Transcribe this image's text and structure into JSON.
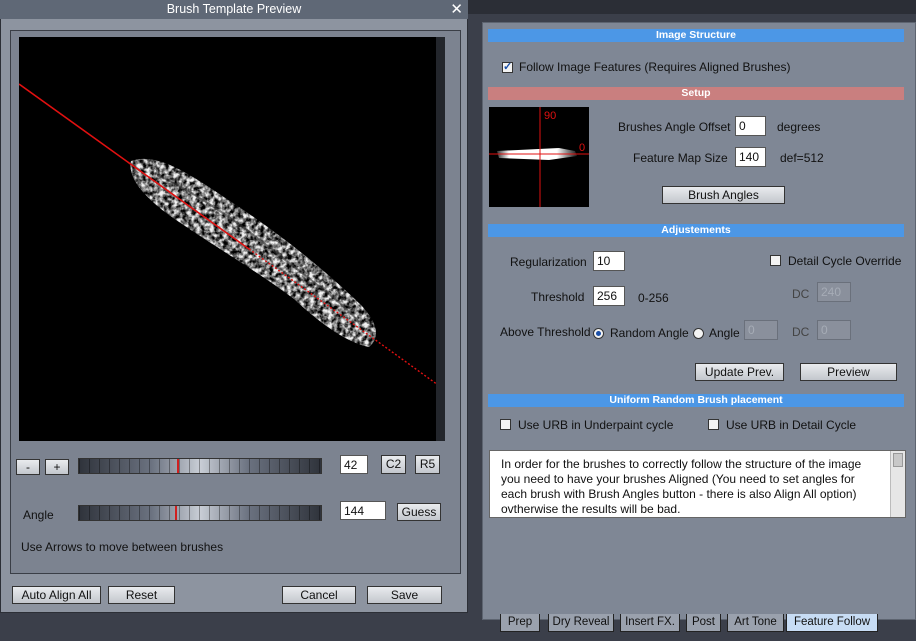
{
  "dialog": {
    "title": "Brush Template Preview",
    "close_label": "✕",
    "minus_label": "-",
    "plus_label": "+",
    "brush_index": "42",
    "c2_label": "C2",
    "r5_label": "R5",
    "angle_label": "Angle",
    "angle_value": "144",
    "guess_label": "Guess",
    "hint": "Use Arrows to move between brushes",
    "auto_align_label": "Auto Align All",
    "reset_label": "Reset",
    "cancel_label": "Cancel",
    "save_label": "Save",
    "slider1_position": 0.35,
    "slider2_position": 0.35
  },
  "panel": {
    "image_structure": {
      "header": "Image Structure",
      "follow_features_label": "Follow Image Features (Requires Aligned Brushes)",
      "follow_features_checked": true
    },
    "setup": {
      "header": "Setup",
      "angle_mark_90": "90",
      "angle_mark_0": "0",
      "brushes_angle_offset_label": "Brushes Angle Offset",
      "brushes_angle_offset_value": "0",
      "degrees_label": "degrees",
      "feature_map_size_label": "Feature Map Size",
      "feature_map_size_value": "140",
      "def_label": "def=512",
      "brush_angles_label": "Brush Angles"
    },
    "adjustments": {
      "header": "Adjustements",
      "regularization_label": "Regularization",
      "regularization_value": "10",
      "detail_cycle_override_label": "Detail Cycle Override",
      "threshold_label": "Threshold",
      "threshold_value": "256",
      "threshold_range": "0-256",
      "dc_label_1": "DC",
      "dc_value_1": "240",
      "above_threshold_label": "Above Threshold",
      "random_angle_label": "Random Angle",
      "angle_label": "Angle",
      "angle_value": "0",
      "dc_label_2": "DC",
      "dc_value_2": "0",
      "update_prev_label": "Update Prev.",
      "preview_label": "Preview"
    },
    "urb": {
      "header": "Uniform Random Brush placement",
      "underpaint_label": "Use URB in Underpaint cycle",
      "detail_label": "Use URB in Detail Cycle"
    },
    "info_text": "In order for the brushes to correctly follow the structure of the image you need to have your brushes Aligned (You need to set angles for each brush with Brush Angles button - there is also Align All option) ovtherwise the results will be bad."
  },
  "tabs": [
    {
      "label": "Prep"
    },
    {
      "label": "Dry Reveal"
    },
    {
      "label": "Insert FX."
    },
    {
      "label": "Post"
    },
    {
      "label": "Art Tone"
    },
    {
      "label": "Feature Follow",
      "active": true
    }
  ],
  "colors": {
    "section_blue": "#4c97e6",
    "section_red": "#c97f7f",
    "guide_line": "#e01010"
  }
}
